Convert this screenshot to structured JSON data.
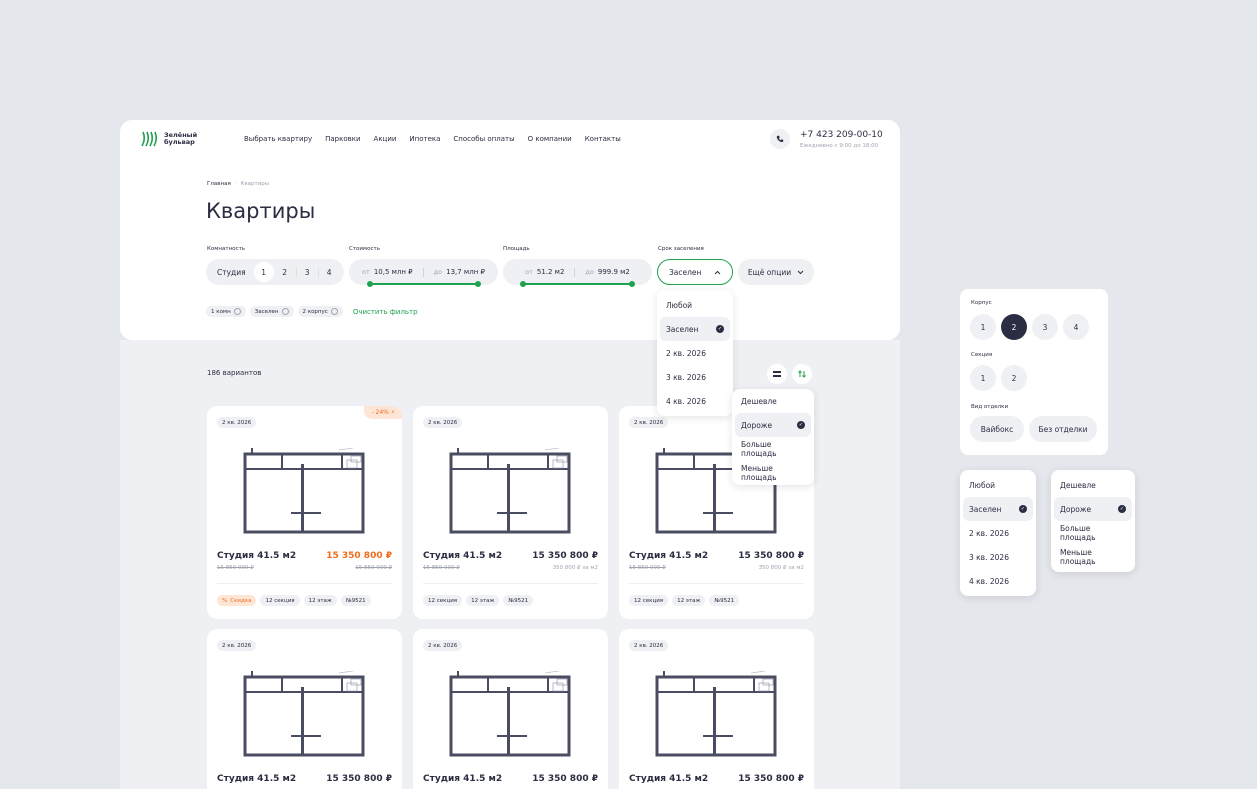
{
  "header": {
    "logo_line1": "Зелёный",
    "logo_line2": "бульвар",
    "nav": [
      "Выбрать квартиру",
      "Парковки",
      "Акции",
      "Ипотека",
      "Способы оплаты",
      "О компании",
      "Контакты"
    ],
    "phone": "+7 423 209-00-10",
    "hours": "Ежедневно с 9:00 до 18:00"
  },
  "breadcrumb": {
    "home": "Главная",
    "sep": "·",
    "current": "Квартиры"
  },
  "page_title": "Квартиры",
  "filters": {
    "rooms": {
      "label": "Комнатность",
      "options": [
        "Студия",
        "1",
        "2",
        "3",
        "4"
      ],
      "selected": "1"
    },
    "price": {
      "label": "Стоимость",
      "from_prefix": "от",
      "from": "10,5 млн ₽",
      "to_prefix": "до",
      "to": "13,7 млн ₽"
    },
    "area": {
      "label": "Площадь",
      "from_prefix": "от",
      "from": "51.2 м2",
      "to_prefix": "до",
      "to": "999.9 м2"
    },
    "term": {
      "label": "Срок заселения",
      "value": "Заселен"
    },
    "more": "Ещё опции",
    "tags": [
      "1 комн",
      "Заселен",
      "2 корпус"
    ],
    "clear": "Очистить фильтр"
  },
  "term_dropdown": {
    "items": [
      "Любой",
      "Заселен",
      "2 кв. 2026",
      "3 кв. 2026",
      "4 кв. 2026"
    ],
    "selected": "Заселен"
  },
  "results_count": "186 вариантов",
  "sort_dropdown": {
    "items": [
      "Дешевле",
      "Дороже",
      "Больше площадь",
      "Меньше площадь"
    ],
    "selected": "Дороже"
  },
  "cards": [
    {
      "date": "2 кв. 2026",
      "discount_badge": "- 24%",
      "title": "Студия 41.5 м2",
      "price": "15 350 800 ₽",
      "price_accent": true,
      "old_price": "15 850 000 ₽",
      "sub_right": "15 850 000 ₽",
      "sub_right_strike": true,
      "tags": [
        "Скидка",
        "12 секция",
        "12 этаж",
        "№9521"
      ],
      "sale": true
    },
    {
      "date": "2 кв. 2026",
      "title": "Студия 41.5 м2",
      "price": "15 350 800 ₽",
      "old_price": "15 850 000 ₽",
      "sub_right": "350 800 ₽ за м2",
      "tags": [
        "12 секция",
        "12 этаж",
        "№9521"
      ]
    },
    {
      "date": "2 кв. 2026",
      "title": "Студия 41.5 м2",
      "price": "15 350 800 ₽",
      "old_price": "15 850 000 ₽",
      "sub_right": "350 800 ₽ за м2",
      "tags": [
        "12 секция",
        "12 этаж",
        "№9521"
      ]
    },
    {
      "date": "2 кв. 2026",
      "title": "Студия 41.5 м2",
      "price": "15 350 800 ₽"
    },
    {
      "date": "2 кв. 2026",
      "title": "Студия 41.5 м2",
      "price": "15 350 800 ₽"
    },
    {
      "date": "2 кв. 2026",
      "title": "Студия 41.5 м2",
      "price": "15 350 800 ₽"
    }
  ],
  "options_panel": {
    "building_label": "Корпус",
    "buildings": [
      "1",
      "2",
      "3",
      "4"
    ],
    "building_selected": "2",
    "section_label": "Секция",
    "sections": [
      "1",
      "2"
    ],
    "finish_label": "Вид отделки",
    "finishes": [
      "Вайбокс",
      "Без отделки"
    ]
  },
  "colors": {
    "accent_green": "#1fa24f",
    "accent_orange": "#f26b1d",
    "dark": "#2b2d42",
    "bg": "#e4e7eb"
  }
}
